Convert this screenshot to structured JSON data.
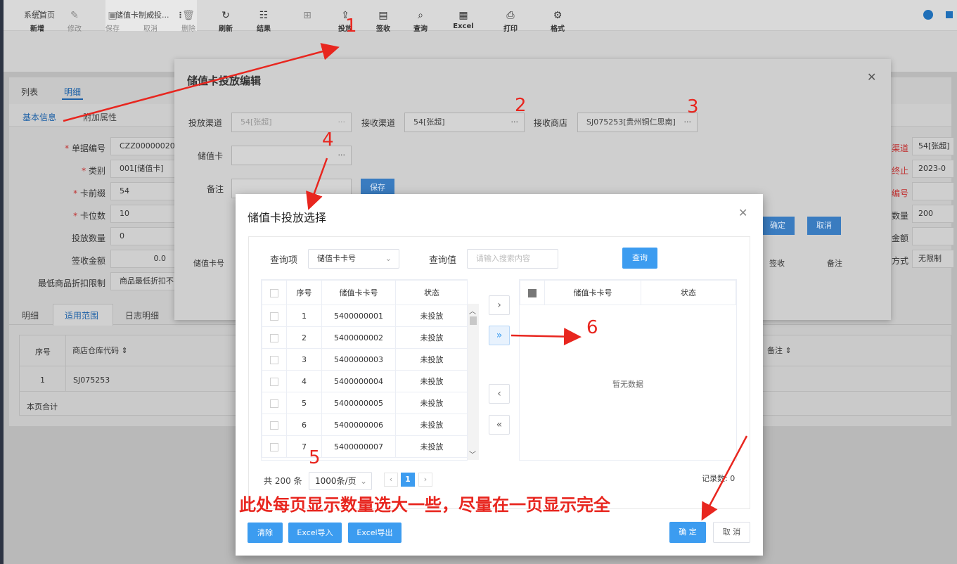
{
  "tabs": {
    "home": "系统首页",
    "active": "储值卡制成投..."
  },
  "toolbar": [
    {
      "icon": "file-plus-icon",
      "label": "新增",
      "disabled": false
    },
    {
      "icon": "edit-icon",
      "label": "修改",
      "disabled": true
    },
    {
      "icon": "save-icon",
      "label": "保存",
      "disabled": true
    },
    {
      "icon": "undo-icon",
      "label": "取消",
      "disabled": true
    },
    {
      "icon": "trash-icon",
      "label": "删除",
      "disabled": true
    },
    {
      "icon": "refresh-icon",
      "label": "刷新",
      "disabled": false
    },
    {
      "icon": "list-icon",
      "label": "结果",
      "disabled": false
    },
    {
      "icon": "plus-square-icon",
      "label": "",
      "disabled": true
    },
    {
      "icon": "upload-icon",
      "label": "投放",
      "disabled": false
    },
    {
      "icon": "clipboard-icon",
      "label": "签收",
      "disabled": false
    },
    {
      "icon": "search-doc-icon",
      "label": "查询",
      "disabled": false
    },
    {
      "icon": "table-icon",
      "label": "Excel",
      "disabled": false
    },
    {
      "icon": "printer-icon",
      "label": "打印",
      "disabled": false
    },
    {
      "icon": "gear-icon",
      "label": "格式",
      "disabled": false
    }
  ],
  "page": {
    "subtabs": [
      "列表",
      "明细"
    ],
    "section_tabs": [
      "基本信息",
      "附加属性"
    ],
    "fields": [
      {
        "label": "单据编号",
        "required": true,
        "value": "CZZ00000020"
      },
      {
        "label": "类别",
        "required": true,
        "value": "001[储值卡]"
      },
      {
        "label": "卡前缀",
        "required": true,
        "value": "54"
      },
      {
        "label": "卡位数",
        "required": true,
        "value": "10"
      },
      {
        "label": "投放数量",
        "required": false,
        "value": "0"
      },
      {
        "label": "签收金额",
        "required": false,
        "value": "0.0"
      },
      {
        "label": "最低商品折扣限制",
        "required": false,
        "value": "商品最低折扣不限"
      }
    ],
    "right_fields": [
      {
        "label": "渠道",
        "value": "54[张超]"
      },
      {
        "label": "终止",
        "value": "2023-0"
      },
      {
        "label": "编号",
        "value": ""
      },
      {
        "label": "数量",
        "value": "200"
      },
      {
        "label": "金额",
        "value": ""
      },
      {
        "label": "方式",
        "value": "无限制"
      }
    ],
    "bottom_tabs": [
      "明细",
      "适用范围",
      "日志明细"
    ],
    "grid": {
      "headers": [
        "序号",
        "商店仓库代码 ⇕",
        "备注 ⇕"
      ],
      "rows": [
        [
          "1",
          "SJ075253"
        ]
      ],
      "footer": "本页合计"
    }
  },
  "modal1": {
    "title": "储值卡投放编辑",
    "channel_label": "投放渠道",
    "channel_value": "54[张超]",
    "recv_channel_label": "接收渠道",
    "recv_channel_value": "54[张超]",
    "recv_store_label": "接收商店",
    "recv_store_value": "SJ075253[贵州铜仁思南]",
    "card_label": "储值卡",
    "card_value": "",
    "remark_label": "备注",
    "save_label": "保存",
    "ok_label": "确定",
    "cancel_label": "取消",
    "col_card": "储值卡号",
    "col_sign": "签收",
    "col_remark": "备注",
    "ellipsis": "···"
  },
  "modal2": {
    "title": "储值卡投放选择",
    "query_item_label": "查询项",
    "query_item_value": "储值卡卡号",
    "query_value_label": "查询值",
    "query_placeholder": "请输入搜索内容",
    "query_button": "查询",
    "left_table": {
      "headers": [
        "序号",
        "储值卡卡号",
        "状态"
      ],
      "rows": [
        [
          "1",
          "5400000001",
          "未投放"
        ],
        [
          "2",
          "5400000002",
          "未投放"
        ],
        [
          "3",
          "5400000003",
          "未投放"
        ],
        [
          "4",
          "5400000004",
          "未投放"
        ],
        [
          "5",
          "5400000005",
          "未投放"
        ],
        [
          "6",
          "5400000006",
          "未投放"
        ],
        [
          "7",
          "5400000007",
          "未投放"
        ]
      ]
    },
    "right_table": {
      "headers": [
        "储值卡卡号",
        "状态"
      ],
      "empty": "暂无数据"
    },
    "transfer_buttons": [
      "›",
      "»",
      "‹",
      "«"
    ],
    "total": "共 200 条",
    "page_size": "1000条/页",
    "current_page": "1",
    "record_count": "记录数: 0",
    "clear_button": "清除",
    "excel_import": "Excel导入",
    "excel_export": "Excel导出",
    "ok_button": "确 定",
    "cancel_button": "取 消"
  },
  "annotations": {
    "numbers": [
      "1",
      "2",
      "3",
      "4",
      "5",
      "6"
    ],
    "note": "此处每页显示数量选大一些，尽量在一页显示完全"
  },
  "colors": {
    "primary": "#3c9cf0",
    "annotation": "#e8261f",
    "sidebar": "#2d3443"
  }
}
